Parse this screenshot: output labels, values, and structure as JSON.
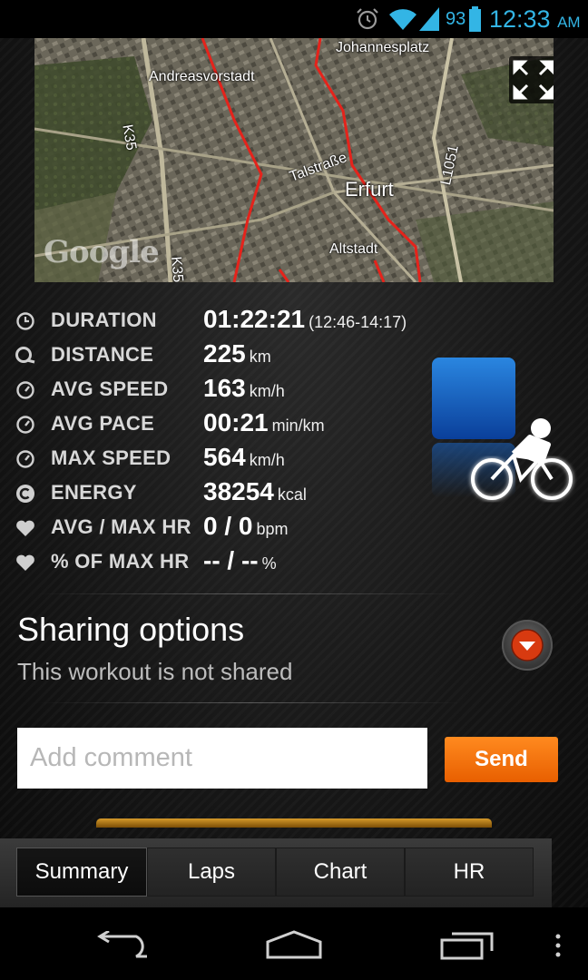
{
  "status_bar": {
    "battery_level": "93",
    "time": "12:33",
    "ampm": "AM",
    "accent_color": "#33b5e5",
    "icons": [
      "alarm-icon",
      "wifi-icon",
      "signal-icon",
      "battery-icon"
    ]
  },
  "map": {
    "labels": {
      "johannesplatz": "Johannesplatz",
      "andreasvorstadt": "Andreasvorstadt",
      "k35_top": "K35",
      "k35_bottom": "K35",
      "talstrasse": "Talstraße",
      "erfurt": "Erfurt",
      "l1051": "L1051",
      "altstadt": "Altstadt"
    },
    "logo": "Google",
    "route_color": "#e5231b"
  },
  "stats": [
    {
      "icon": "clock-icon",
      "label": "DURATION",
      "value": "01:22:21",
      "unit": "(12:46-14:17)"
    },
    {
      "icon": "distance-icon",
      "label": "DISTANCE",
      "value": "225",
      "unit": "km"
    },
    {
      "icon": "speed-icon",
      "label": "AVG SPEED",
      "value": "163",
      "unit": "km/h"
    },
    {
      "icon": "pace-icon",
      "label": "AVG PACE",
      "value": "00:21",
      "unit": "min/km"
    },
    {
      "icon": "max-speed-icon",
      "label": "MAX SPEED",
      "value": "564",
      "unit": "km/h"
    },
    {
      "icon": "energy-icon",
      "label": "ENERGY",
      "value": "38254",
      "unit": "kcal"
    },
    {
      "icon": "heart-icon",
      "label": "AVG / MAX HR",
      "value": "0 / 0",
      "unit": "bpm"
    },
    {
      "icon": "heart-icon",
      "label": "% OF MAX HR",
      "value": "-- / --",
      "unit": "%"
    }
  ],
  "sport": {
    "icon": "cycling-icon"
  },
  "sharing": {
    "title": "Sharing options",
    "subtitle": "This workout is not shared"
  },
  "comment": {
    "placeholder": "Add comment",
    "value": "",
    "send_label": "Send"
  },
  "tabs": [
    {
      "label": "Summary",
      "active": true
    },
    {
      "label": "Laps",
      "active": false
    },
    {
      "label": "Chart",
      "active": false
    },
    {
      "label": "HR",
      "active": false
    }
  ],
  "colors": {
    "accent_orange": "#f07514",
    "text_gray": "#bdbdbd"
  }
}
